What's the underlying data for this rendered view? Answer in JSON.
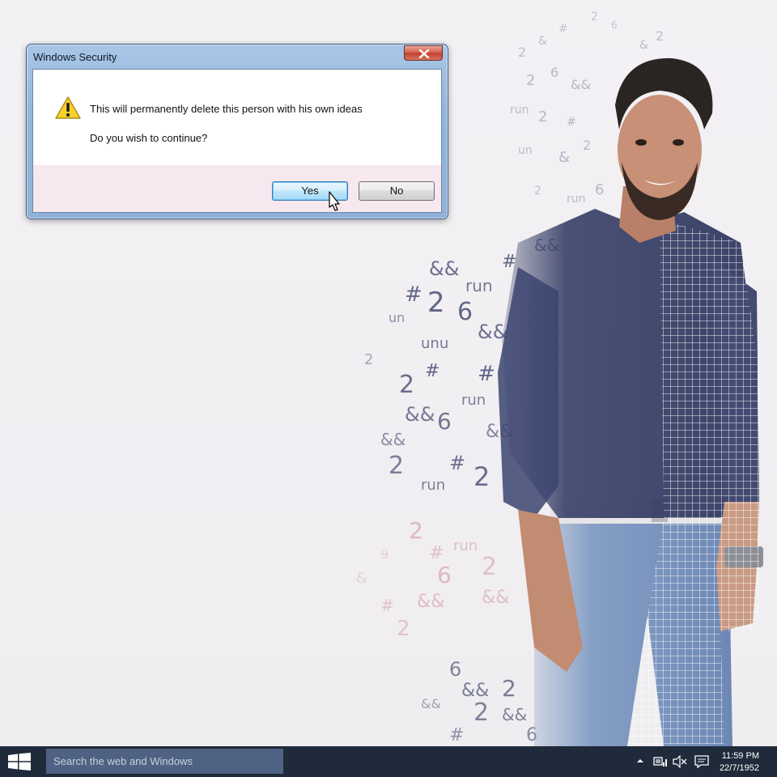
{
  "dialog": {
    "title": "Windows Security",
    "message": "This will permanently delete this person with his own ideas",
    "question": "Do you wish to continue?",
    "yes_label": "Yes",
    "no_label": "No"
  },
  "taskbar": {
    "search_placeholder": "Search the web and Windows",
    "time": "11:59 PM",
    "date": "22/7/1952"
  },
  "icons": {
    "close": "close-icon",
    "warning": "warning-icon",
    "cursor": "mouse-cursor-icon",
    "start": "windows-logo-icon",
    "tray": [
      "chevron-up-icon",
      "network-icon",
      "volume-muted-icon",
      "notification-icon"
    ]
  },
  "colors": {
    "taskbar": "#1f2a3a",
    "search_box": "#4f6283",
    "dialog_frame": "#93b5dc",
    "dialog_footer": "#f6e8ee",
    "close_button": "#c7503b",
    "shirt": "#373f66",
    "jeans": "#7f9ac3"
  }
}
